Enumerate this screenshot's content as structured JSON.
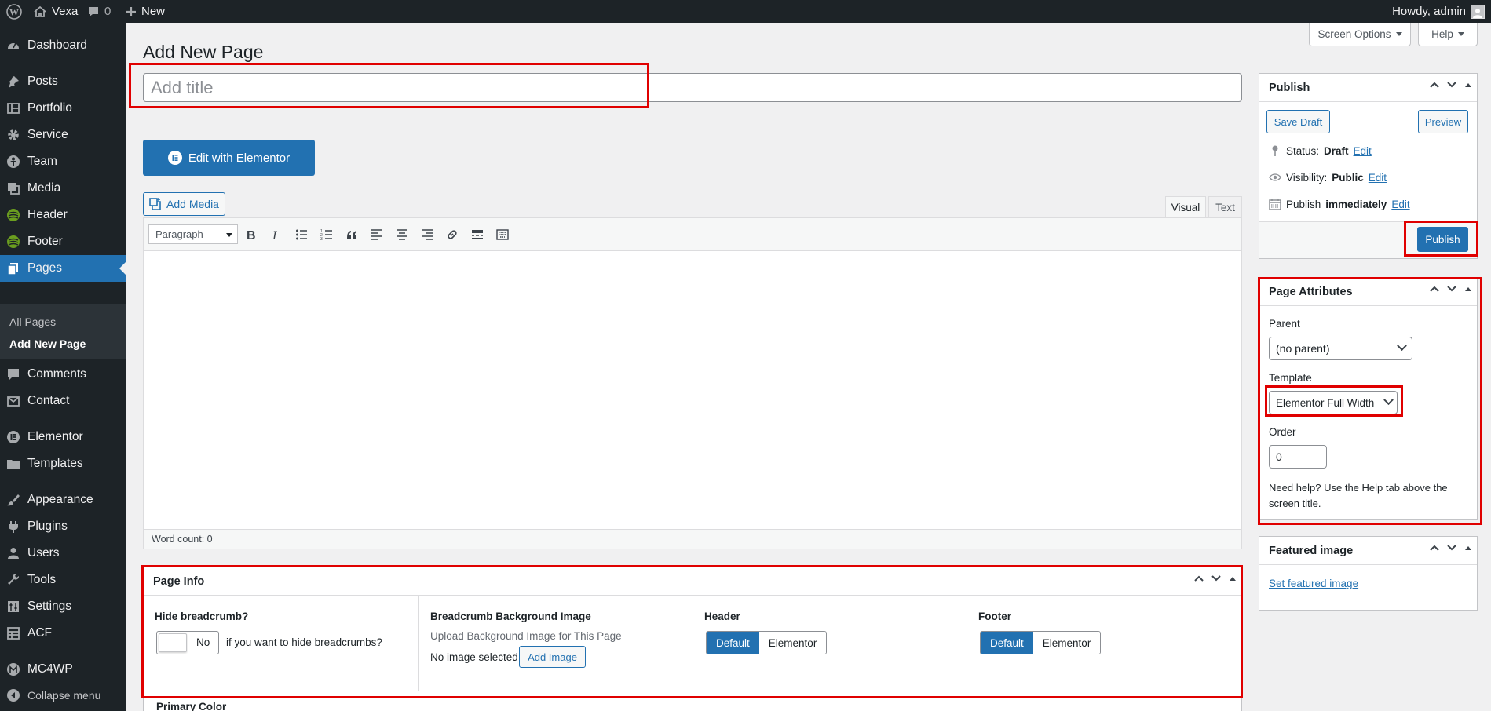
{
  "adminbar": {
    "site_name": "Vexa",
    "comments_count": "0",
    "new_label": "New",
    "howdy": "Howdy, admin"
  },
  "sidebar": {
    "items": [
      {
        "label": "Dashboard",
        "icon": "dashboard-icon"
      },
      {
        "label": "Posts",
        "icon": "pin-icon"
      },
      {
        "label": "Portfolio",
        "icon": "portfolio-icon"
      },
      {
        "label": "Service",
        "icon": "gear-icon"
      },
      {
        "label": "Team",
        "icon": "team-icon"
      },
      {
        "label": "Media",
        "icon": "media-icon"
      },
      {
        "label": "Header",
        "icon": "header-icon"
      },
      {
        "label": "Footer",
        "icon": "footer-icon"
      },
      {
        "label": "Pages",
        "icon": "pages-icon"
      },
      {
        "label": "Comments",
        "icon": "comment-icon"
      },
      {
        "label": "Contact",
        "icon": "mail-icon"
      },
      {
        "label": "Elementor",
        "icon": "elementor-icon"
      },
      {
        "label": "Templates",
        "icon": "folder-icon"
      },
      {
        "label": "Appearance",
        "icon": "brush-icon"
      },
      {
        "label": "Plugins",
        "icon": "plug-icon"
      },
      {
        "label": "Users",
        "icon": "user-icon"
      },
      {
        "label": "Tools",
        "icon": "wrench-icon"
      },
      {
        "label": "Settings",
        "icon": "settings-icon"
      },
      {
        "label": "ACF",
        "icon": "acf-icon"
      },
      {
        "label": "MC4WP",
        "icon": "mc4wp-icon"
      },
      {
        "label": "Collapse menu",
        "icon": "collapse-icon"
      }
    ],
    "submenu": [
      "All Pages",
      "Add New Page"
    ]
  },
  "header": {
    "title": "Add New Page",
    "screen_options": "Screen Options",
    "help": "Help"
  },
  "editor": {
    "title_placeholder": "Add title",
    "elementor_button": "Edit with Elementor",
    "add_media": "Add Media",
    "tab_visual": "Visual",
    "tab_text": "Text",
    "format_select": "Paragraph",
    "word_count": "Word count: 0"
  },
  "publish": {
    "title": "Publish",
    "save_draft": "Save Draft",
    "preview": "Preview",
    "status_label": "Status:",
    "status_value": "Draft",
    "visibility_label": "Visibility:",
    "visibility_value": "Public",
    "publish_label": "Publish",
    "publish_value": "immediately",
    "edit": "Edit",
    "publish_button": "Publish"
  },
  "page_attributes": {
    "title": "Page Attributes",
    "parent_label": "Parent",
    "parent_value": "(no parent)",
    "template_label": "Template",
    "template_value": "Elementor Full Width",
    "order_label": "Order",
    "order_value": "0",
    "help_text": "Need help? Use the Help tab above the screen title."
  },
  "featured_image": {
    "title": "Featured image",
    "link": "Set featured image"
  },
  "page_info": {
    "title": "Page Info",
    "hide_breadcrumb_label": "Hide breadcrumb?",
    "toggle_value": "No",
    "toggle_desc": "if you want to hide breadcrumbs?",
    "bg_image_label": "Breadcrumb Background Image",
    "bg_image_desc": "Upload Background Image for This Page",
    "no_image": "No image selected",
    "add_image": "Add Image",
    "header_label": "Header",
    "footer_label": "Footer",
    "opt_default": "Default",
    "opt_elementor": "Elementor",
    "primary_color_label": "Primary Color"
  },
  "colors": {
    "accent": "#2271b1",
    "highlight": "#e00000",
    "sidebar_bg": "#1d2327"
  }
}
